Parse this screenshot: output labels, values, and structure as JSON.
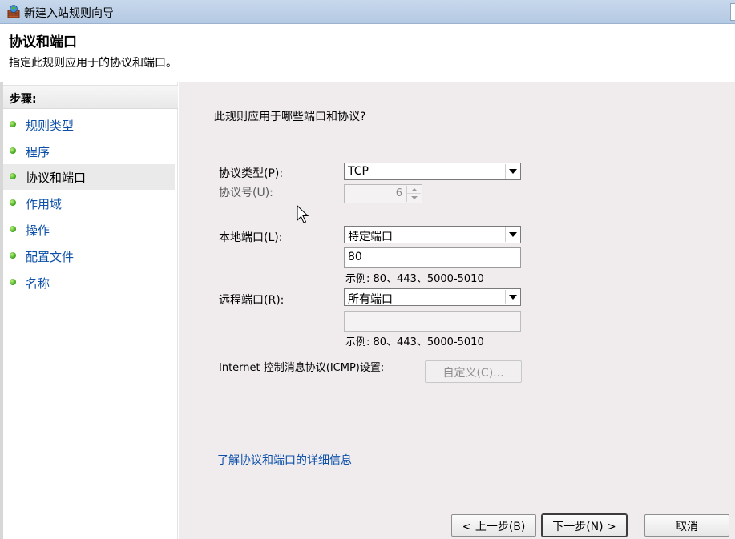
{
  "window": {
    "title": "新建入站规则向导",
    "icon": "firewall-wizard-icon"
  },
  "header": {
    "title": "协议和端口",
    "subtitle": "指定此规则应用于的协议和端口。"
  },
  "sidebar": {
    "heading": "步骤:",
    "current_index": 2,
    "items": [
      {
        "label": "规则类型"
      },
      {
        "label": "程序"
      },
      {
        "label": "协议和端口"
      },
      {
        "label": "作用域"
      },
      {
        "label": "操作"
      },
      {
        "label": "配置文件"
      },
      {
        "label": "名称"
      }
    ]
  },
  "main": {
    "question": "此规则应用于哪些端口和协议?",
    "protocol_type": {
      "label": "协议类型(P):",
      "value": "TCP"
    },
    "protocol_number": {
      "label": "协议号(U):",
      "value": "6"
    },
    "local_port": {
      "label": "本地端口(L):",
      "value": "特定端口",
      "input_value": "80",
      "example": "示例: 80、443、5000-5010"
    },
    "remote_port": {
      "label": "远程端口(R):",
      "value": "所有端口",
      "input_value": "",
      "example": "示例: 80、443、5000-5010"
    },
    "icmp": {
      "label": "Internet 控制消息协议(ICMP)设置:",
      "button": "自定义(C)..."
    },
    "learn_more_link": "了解协议和端口的详细信息"
  },
  "footer": {
    "back_button": "< 上一步(B)",
    "next_button": "下一步(N) >",
    "cancel_button": "取消"
  },
  "colors": {
    "titlebar": "#b4c9e3",
    "main_background": "#f0ecee",
    "link": "#0b4fa8",
    "step_dot": "#3aa11a"
  }
}
